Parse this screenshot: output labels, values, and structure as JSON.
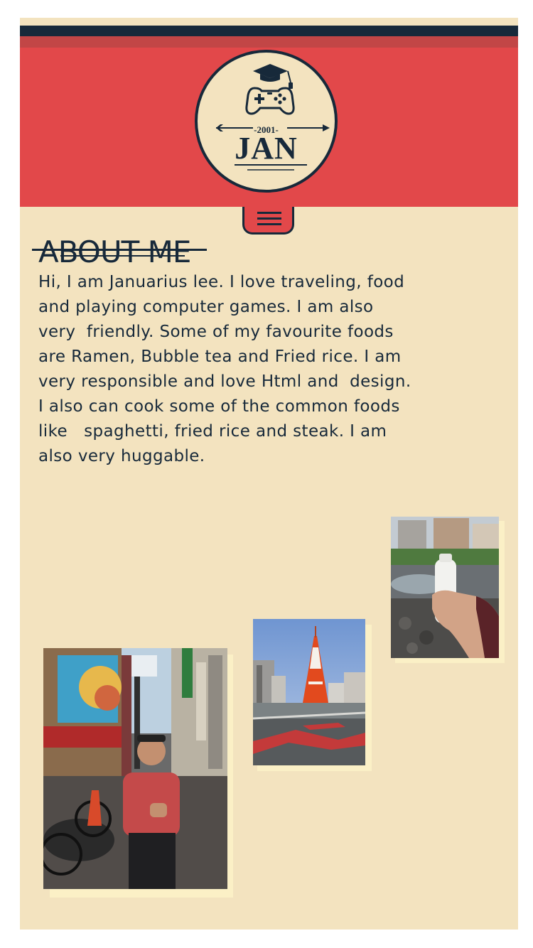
{
  "header": {
    "logo_year": "-2001-",
    "logo_name": "JAN"
  },
  "about": {
    "title": "ABOUT ME",
    "bio": "Hi, I am Januarius lee. I love traveling, food\nand playing computer games. I am also\nvery  friendly. Some of my favourite foods\nare Ramen, Bubble tea and Fried rice. I am\nvery responsible and love Html and  design.\nI also can cook some of the common foods\nlike   spaghetti, fried rice and steak. I am\nalso very huggable."
  },
  "icons": {
    "logo_cap": "graduation-cap-icon",
    "logo_controller": "gamepad-icon",
    "logo_arrow": "arrow-icon",
    "menu": "hamburger-menu-icon"
  },
  "colors": {
    "background": "#f3e3bf",
    "banner": "#e2484a",
    "dark": "#17293a"
  }
}
